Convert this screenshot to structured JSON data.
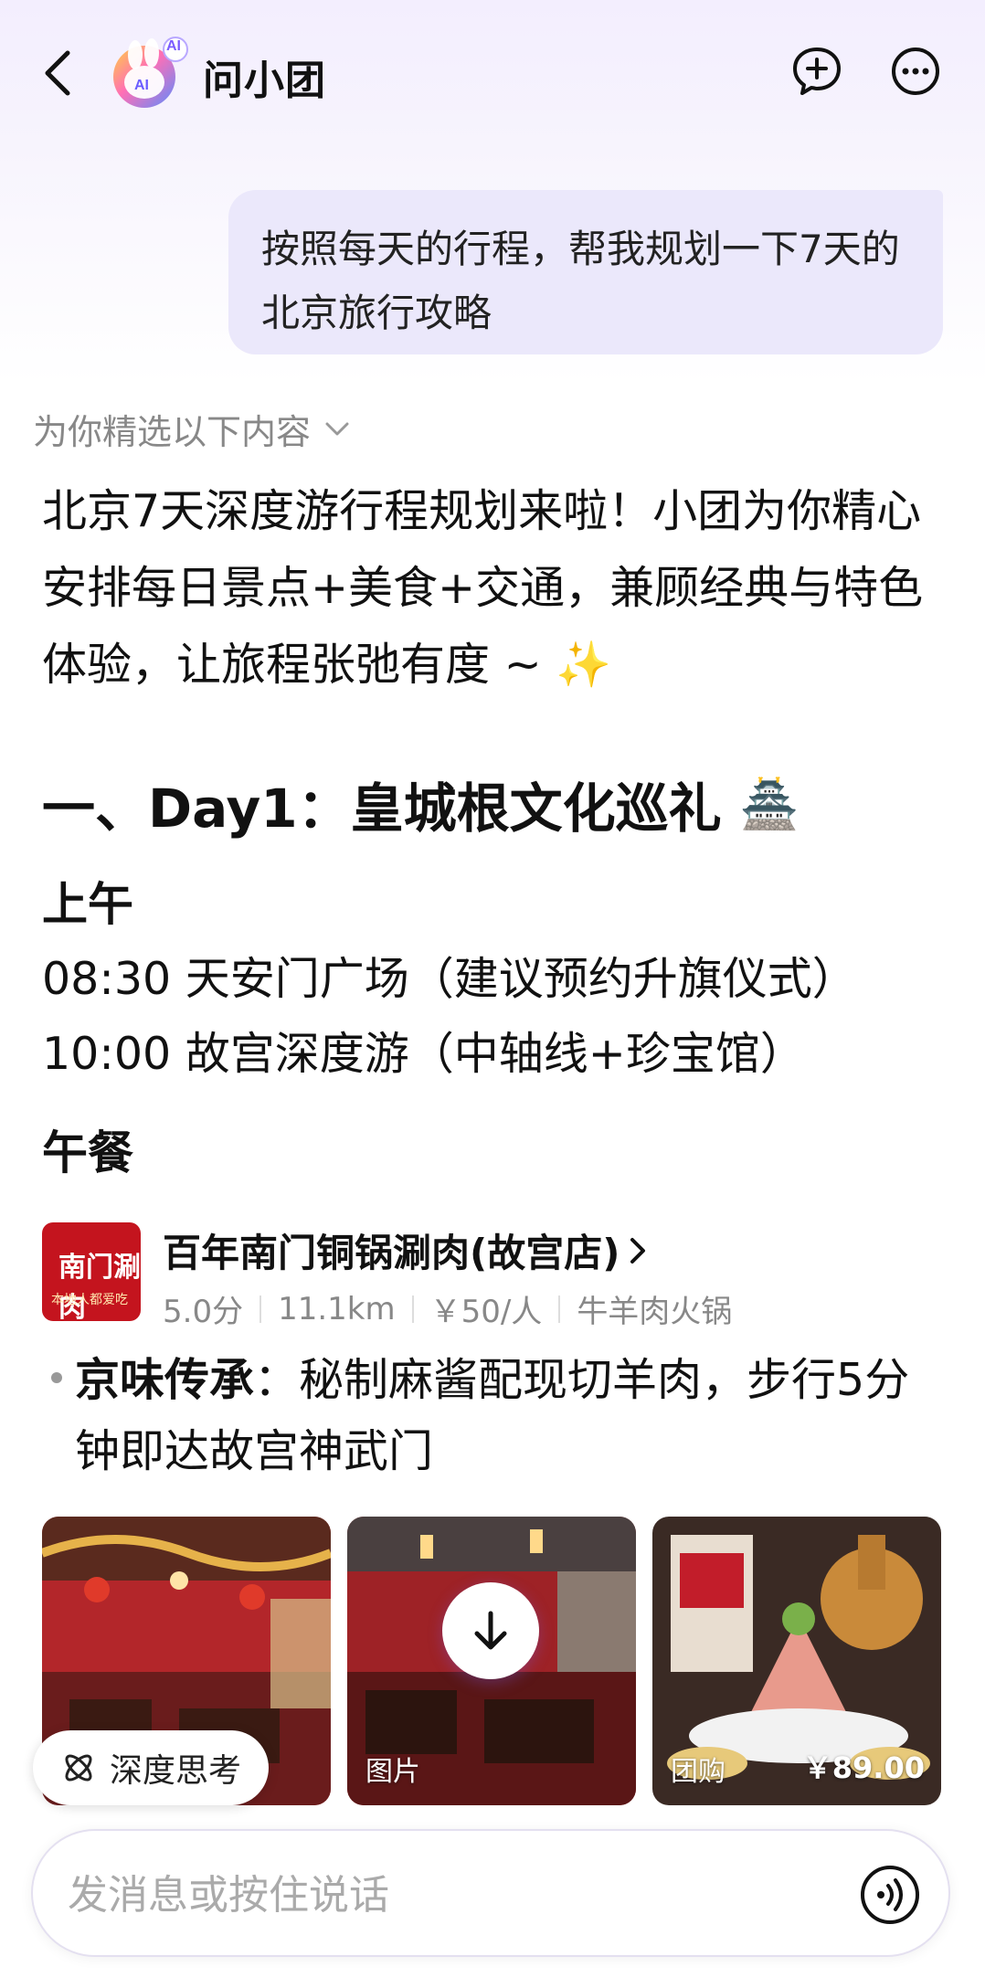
{
  "header": {
    "title": "问小团",
    "logo_badge": "AI",
    "icons": {
      "back": "back-chevron-icon",
      "new_chat": "new-chat-icon",
      "more": "more-dots-icon"
    }
  },
  "chat": {
    "user_message": "按照每天的行程，帮我规划一下7天的北京旅行攻略",
    "selection_hint": "为你精选以下内容",
    "intro": "北京7天深度游行程规划来啦！小团为你精心安排每日景点+美食+交通，兼顾经典与特色体验，让旅程张弛有度 ~ ✨",
    "day1": {
      "heading": "一、Day1：皇城根文化巡礼",
      "heading_emoji": "🏯",
      "morning_label": "上午",
      "items": [
        "08:30 天安门广场（建议预约升旗仪式）",
        "10:00 故宫深度游（中轴线+珍宝馆）"
      ],
      "lunch_label": "午餐"
    },
    "restaurant": {
      "logo_text": "南门涮肉",
      "logo_slogan": "本地人都爱吃",
      "name": "百年南门铜锅涮肉(故宫店)",
      "rating": "5.0分",
      "distance": "11.1km",
      "price": "￥50/人",
      "category": "牛羊肉火锅",
      "highlight_title": "京味传承",
      "highlight_text": "：秘制麻酱配现切羊肉，步行5分钟即达故宫神武门",
      "photos": [
        {
          "label": ""
        },
        {
          "label": "图片"
        },
        {
          "label": "团购",
          "price": "￥89.00"
        }
      ]
    }
  },
  "controls": {
    "deep_think": "深度思考",
    "input_placeholder": "发消息或按住说话"
  },
  "colors": {
    "accent": "#7b5cff",
    "bubble": "#ebe8fb",
    "brand_red": "#c4141e"
  }
}
